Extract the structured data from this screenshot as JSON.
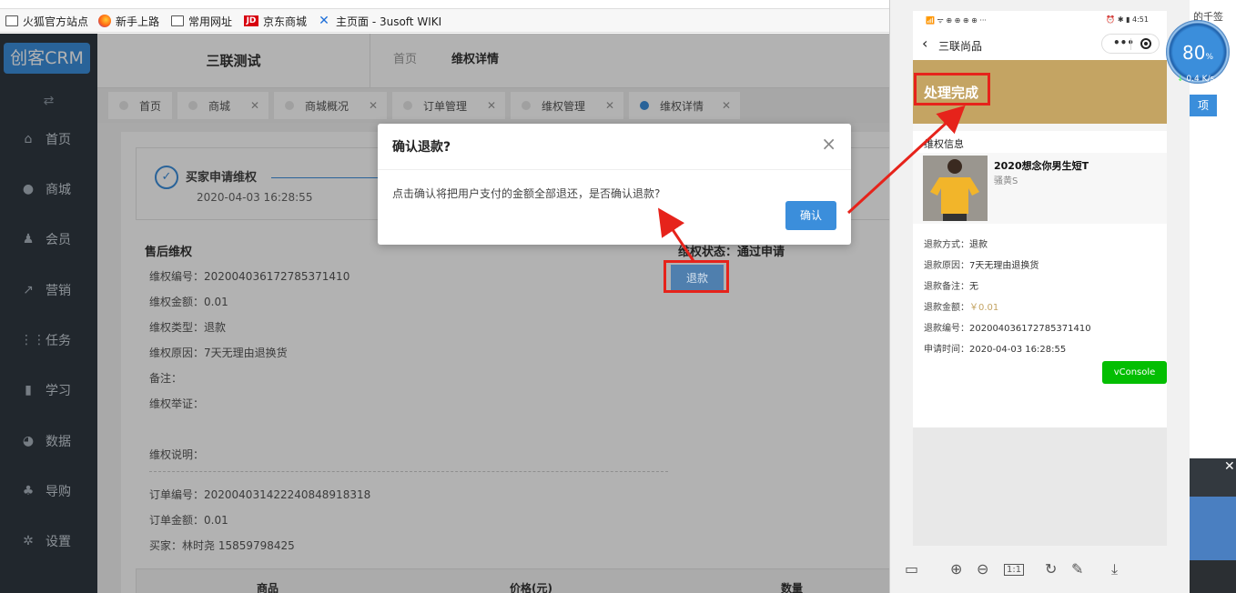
{
  "bookmarks": [
    {
      "label": "火狐官方站点",
      "icon": "folder-icon"
    },
    {
      "label": "新手上路",
      "icon": "firefox-icon"
    },
    {
      "label": "常用网址",
      "icon": "folder-icon"
    },
    {
      "label": "京东商城",
      "icon": "jd-icon",
      "icon_text": "JD"
    },
    {
      "label": "主页面 - 3usoft WIKI",
      "icon": "confluence-icon"
    }
  ],
  "sidebar": {
    "logo": "创客CRM",
    "swap_icon": "⇄",
    "items": [
      {
        "label": "首页",
        "icon": "home-icon"
      },
      {
        "label": "商城",
        "icon": "shop-icon"
      },
      {
        "label": "会员",
        "icon": "user-icon"
      },
      {
        "label": "营销",
        "icon": "trend-icon"
      },
      {
        "label": "任务",
        "icon": "grid-icon"
      },
      {
        "label": "学习",
        "icon": "book-icon"
      },
      {
        "label": "数据",
        "icon": "pie-icon"
      },
      {
        "label": "导购",
        "icon": "guide-icon"
      },
      {
        "label": "设置",
        "icon": "gear-icon"
      }
    ]
  },
  "header": {
    "shop_name": "三联测试",
    "breadcrumb": [
      "首页",
      "维权详情"
    ]
  },
  "tabs": [
    {
      "label": "首页",
      "closable": false,
      "active": false
    },
    {
      "label": "商城",
      "closable": true,
      "active": false
    },
    {
      "label": "商城概况",
      "closable": true,
      "active": false
    },
    {
      "label": "订单管理",
      "closable": true,
      "active": false
    },
    {
      "label": "维权管理",
      "closable": true,
      "active": false
    },
    {
      "label": "维权详情",
      "closable": true,
      "active": true
    }
  ],
  "steps": {
    "title": "买家申请维权",
    "time": "2020-04-03 16:28:55"
  },
  "after_sale": {
    "title": "售后维权",
    "status_label": "维权状态：通过申请",
    "refund_button": "退款",
    "rows": [
      "维权编号：202004036172785371410",
      "维权金额：0.01",
      "维权类型：退款",
      "维权原因：7天无理由退换货",
      "备注：",
      "维权举证：",
      "维权说明："
    ],
    "order_rows": [
      "订单编号：20200403142224084891831­8",
      "订单金额：0.01",
      "买家：林时尧 15859798425"
    ]
  },
  "table": {
    "headers": [
      "商品",
      "价格(元)",
      "数量"
    ]
  },
  "modal": {
    "title": "确认退款?",
    "text": "点击确认将把用户支付的金额全部退还，是否确认退款?",
    "confirm": "确认",
    "close_icon": "×"
  },
  "phone": {
    "status_left": "📶 ᯤ ⊕ ⊕ ⊕ ⊕ ···",
    "status_right": "⏰ ✱ ▮ 4:51",
    "nav_title": "三联尚品",
    "status_text": "处理完成",
    "section_title": "维权信息",
    "product_name": "2020想念你男生短T",
    "product_spec": "骚黄S",
    "rows": [
      {
        "label": "退款方式：",
        "value": "退款"
      },
      {
        "label": "退款原因：",
        "value": "7天无理由退换货"
      },
      {
        "label": "退款备注：",
        "value": "无"
      },
      {
        "label": "退款金额：",
        "value": "￥0.01"
      },
      {
        "label": "退款编号：",
        "value": "202004036172785371410"
      },
      {
        "label": "申请时间：",
        "value": "2020-04-03 16:28:55"
      }
    ],
    "vconsole": "vConsole"
  },
  "speed_widget": {
    "percent": "80",
    "percent_unit": "%",
    "rate": "0.4 K/s",
    "top_text": "的千签"
  },
  "far_right": {
    "badge": "项",
    "close_icon": "✕"
  },
  "colors": {
    "sidebar_bg": "#303841",
    "accent": "#3b8edb",
    "banner": "#c4a463",
    "highlight": "#e6231b",
    "vconsole": "#04be02"
  }
}
